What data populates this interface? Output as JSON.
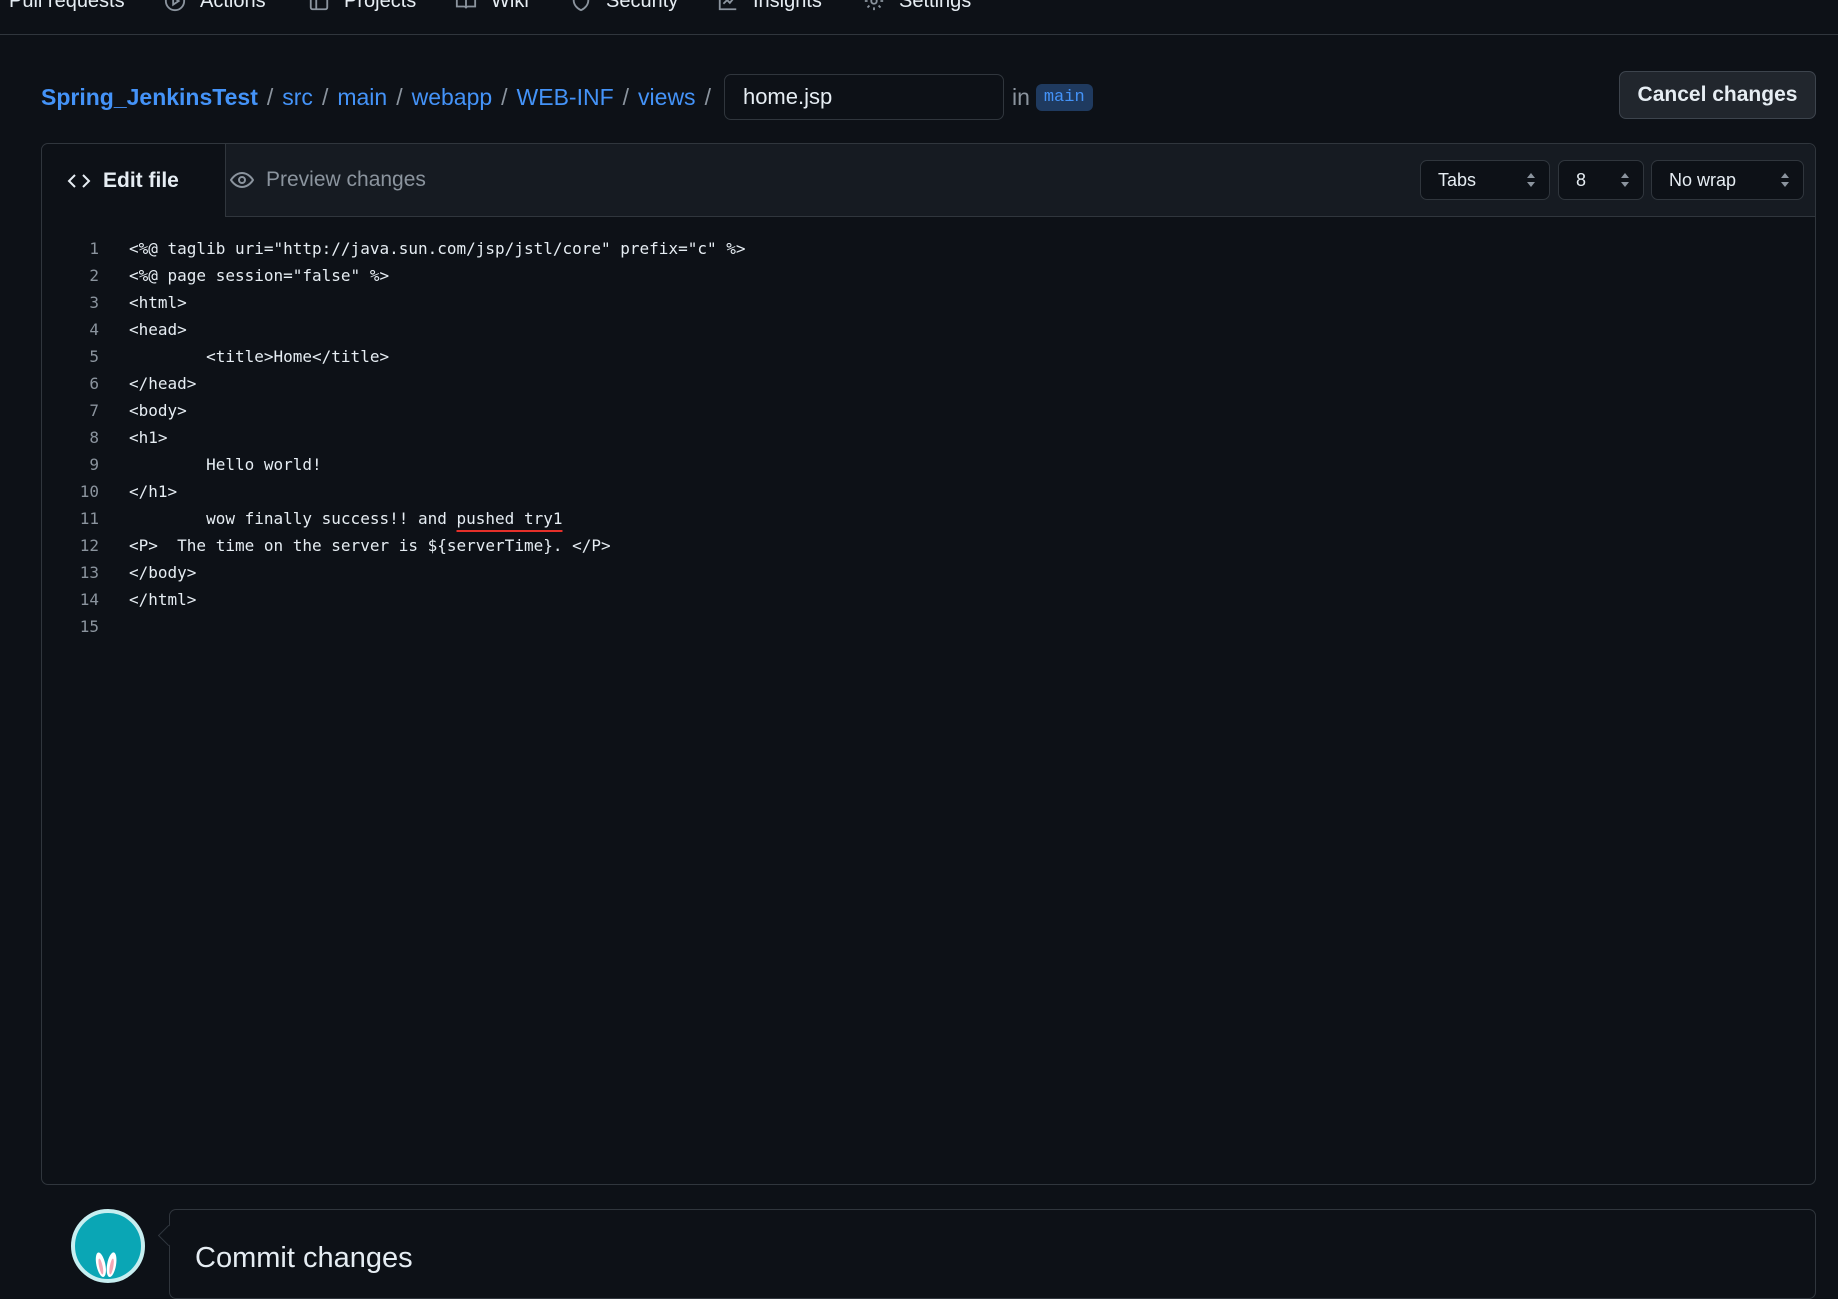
{
  "nav": {
    "items": [
      {
        "label": "Pull requests",
        "icon": "pull-request-icon"
      },
      {
        "label": "Actions",
        "icon": "play-circle-icon"
      },
      {
        "label": "Projects",
        "icon": "table-icon"
      },
      {
        "label": "Wiki",
        "icon": "book-icon"
      },
      {
        "label": "Security",
        "icon": "shield-icon"
      },
      {
        "label": "Insights",
        "icon": "graph-icon"
      },
      {
        "label": "Settings",
        "icon": "gear-icon"
      }
    ]
  },
  "breadcrumb": {
    "repo": "Spring_JenkinsTest",
    "path": [
      "src",
      "main",
      "webapp",
      "WEB-INF",
      "views"
    ],
    "separator": "/",
    "filename": "home.jsp",
    "in_label": "in",
    "branch": "main"
  },
  "actions": {
    "cancel_label": "Cancel changes"
  },
  "editor": {
    "tabs": {
      "edit": "Edit file",
      "preview": "Preview changes"
    },
    "indent_mode": "Tabs",
    "indent_size": "8",
    "wrap_mode": "No wrap",
    "lines": [
      "<%@ taglib uri=\"http://java.sun.com/jsp/jstl/core\" prefix=\"c\" %>",
      "<%@ page session=\"false\" %>",
      "<html>",
      "<head>",
      "        <title>Home</title>",
      "</head>",
      "<body>",
      "<h1>",
      "        Hello world!",
      "</h1>",
      "        wow finally success!! and pushed try1",
      "<P>  The time on the server is ${serverTime}. </P>",
      "</body>",
      "</html>",
      ""
    ],
    "misspelled_line": 11,
    "misspelled_text": "pushed try1"
  },
  "commit": {
    "title": "Commit changes"
  },
  "colors": {
    "background": "#0d1117",
    "link": "#4493f8",
    "border": "#30363d",
    "spell_error": "#e5302a"
  }
}
